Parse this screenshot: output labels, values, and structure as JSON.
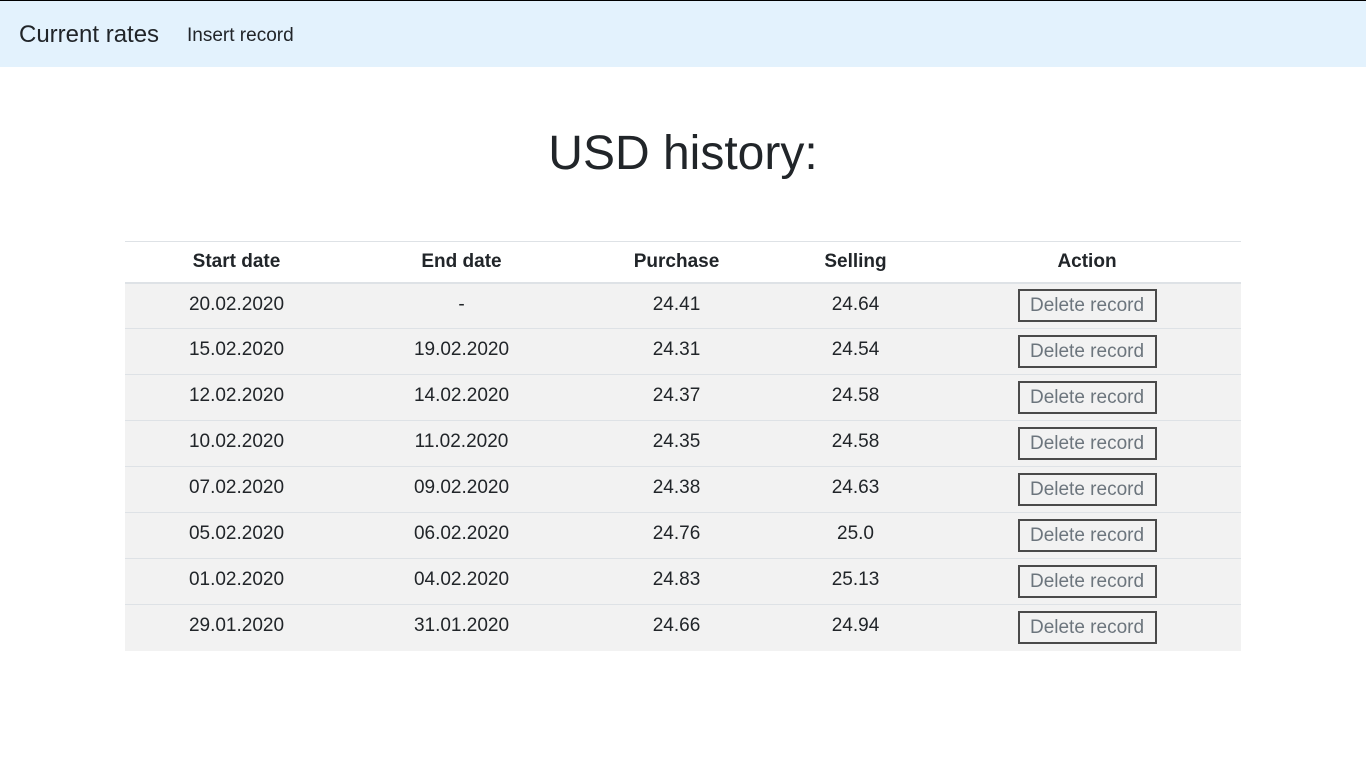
{
  "navbar": {
    "brand": "Current rates",
    "insert_link": "Insert record"
  },
  "page_title": "USD history:",
  "table": {
    "headers": {
      "start_date": "Start date",
      "end_date": "End date",
      "purchase": "Purchase",
      "selling": "Selling",
      "action": "Action"
    },
    "delete_label": "Delete record",
    "rows": [
      {
        "start": "20.02.2020",
        "end": "-",
        "purchase": "24.41",
        "selling": "24.64"
      },
      {
        "start": "15.02.2020",
        "end": "19.02.2020",
        "purchase": "24.31",
        "selling": "24.54"
      },
      {
        "start": "12.02.2020",
        "end": "14.02.2020",
        "purchase": "24.37",
        "selling": "24.58"
      },
      {
        "start": "10.02.2020",
        "end": "11.02.2020",
        "purchase": "24.35",
        "selling": "24.58"
      },
      {
        "start": "07.02.2020",
        "end": "09.02.2020",
        "purchase": "24.38",
        "selling": "24.63"
      },
      {
        "start": "05.02.2020",
        "end": "06.02.2020",
        "purchase": "24.76",
        "selling": "25.0"
      },
      {
        "start": "01.02.2020",
        "end": "04.02.2020",
        "purchase": "24.83",
        "selling": "25.13"
      },
      {
        "start": "29.01.2020",
        "end": "31.01.2020",
        "purchase": "24.66",
        "selling": "24.94"
      }
    ]
  }
}
